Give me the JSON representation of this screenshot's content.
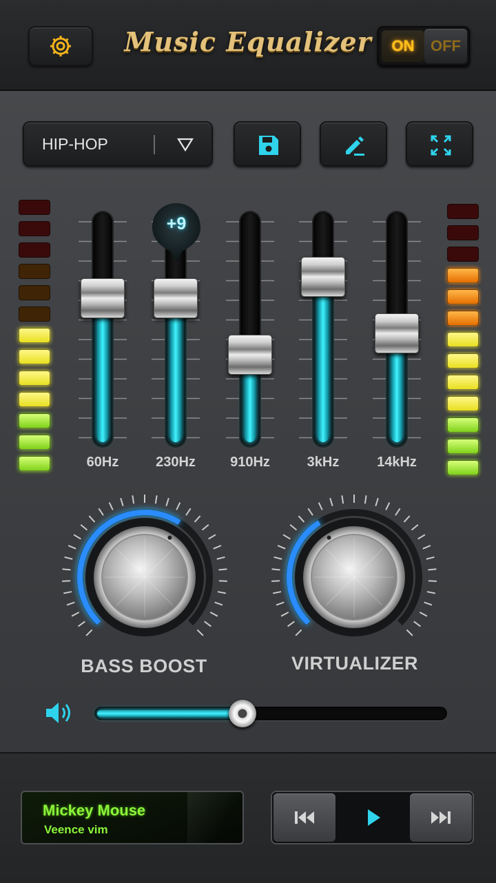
{
  "header": {
    "title": "Music Equalizer",
    "power": {
      "on_label": "ON",
      "off_label": "OFF",
      "state": "on"
    }
  },
  "toolbar": {
    "preset": "HIP-HOP",
    "icons": [
      "save-icon",
      "edit-icon",
      "fullscreen-icon"
    ]
  },
  "equalizer": {
    "active_value_label": "+9",
    "bands": [
      {
        "label": "60Hz",
        "level": 0.66
      },
      {
        "label": "230Hz",
        "level": 0.66
      },
      {
        "label": "910Hz",
        "level": 0.37
      },
      {
        "label": "3kHz",
        "level": 0.77
      },
      {
        "label": "14kHz",
        "level": 0.48
      }
    ]
  },
  "effects": {
    "bass_boost": {
      "label": "BASS BOOST",
      "level": 0.62
    },
    "virtualizer": {
      "label": "VIRTUALIZER",
      "level": 0.38
    }
  },
  "volume": {
    "level": 0.42
  },
  "now_playing": {
    "title": "Mickey Mouse",
    "artist": "Veence vim"
  },
  "colors": {
    "accent": "#3ff3ff",
    "title_gold": "#e3c17a",
    "track_green": "#8cf53a",
    "power_on": "#ffbe1a"
  }
}
